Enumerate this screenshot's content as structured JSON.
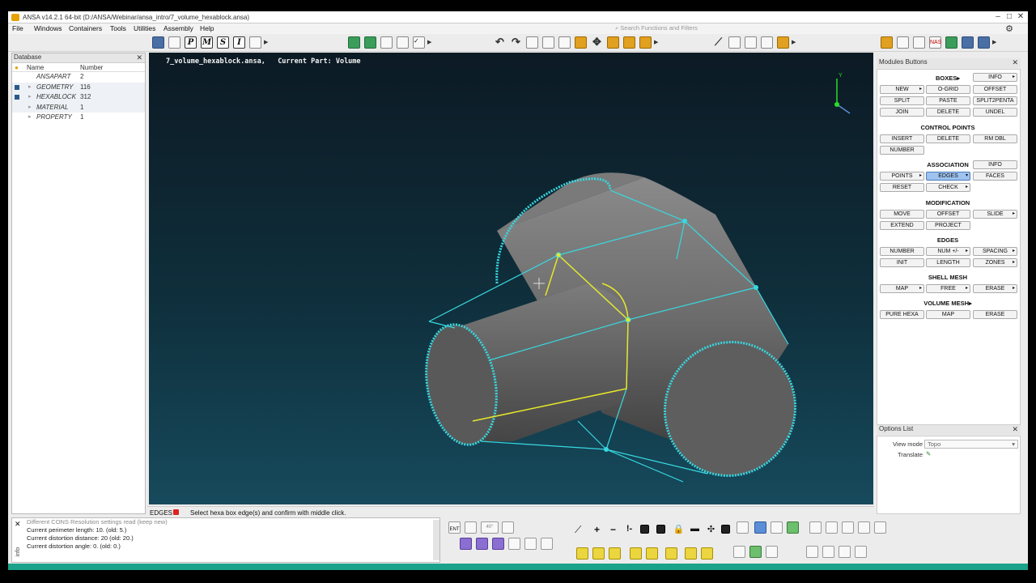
{
  "window": {
    "title": "ANSA v14.2.1 64-bit (D:/ANSA/Webinar/ansa_intro/7_volume_hexablock.ansa)"
  },
  "menu": [
    "File",
    "Windows",
    "Containers",
    "Tools",
    "Utilities",
    "Assembly",
    "Help"
  ],
  "search": {
    "placeholder": "Search Functions and Filters"
  },
  "database": {
    "title": "Database",
    "columns": {
      "name": "Name",
      "number": "Number"
    },
    "rows": [
      {
        "name": "ANSAPART",
        "number": "2"
      },
      {
        "name": "GEOMETRY",
        "number": "116"
      },
      {
        "name": "HEXABLOCK",
        "number": "312"
      },
      {
        "name": "MATERIAL",
        "number": "1"
      },
      {
        "name": "PROPERTY",
        "number": "1"
      }
    ]
  },
  "viewport": {
    "file_label": "7_volume_hexablock.ansa,",
    "part_label": "Current Part: Volume"
  },
  "modules": {
    "title": "Modules Buttons",
    "sections": {
      "boxes": "BOXES",
      "control_points": "CONTROL POINTS",
      "association": "ASSOCIATION",
      "modification": "MODIFICATION",
      "edges": "EDGES",
      "shell_mesh": "SHELL MESH",
      "volume_mesh": "VOLUME MESH"
    },
    "buttons": {
      "boxes_info": "INFO",
      "new": "NEW",
      "ogrid": "O-GRID",
      "offset": "OFFSET",
      "split": "SPLIT",
      "paste": "PASTE",
      "split2penta": "SPLIT2PENTA",
      "join": "JOIN",
      "delete": "DELETE",
      "undel": "UNDEL",
      "insert": "INSERT",
      "cp_delete": "DELETE",
      "rm_dbl": "RM DBL",
      "number": "NUMBER",
      "assoc_info": "INFO",
      "points": "POINTS",
      "edges": "EDGES",
      "faces": "FACES",
      "reset": "RESET",
      "check": "CHECK",
      "move": "MOVE",
      "mod_offset": "OFFSET",
      "slide": "SLIDE",
      "extend": "EXTEND",
      "project": "PROJECT",
      "e_number": "NUMBER",
      "num_pm": "NUM +/-",
      "spacing": "SPACING",
      "init": "INIT",
      "length": "LENGTH",
      "zones": "ZONES",
      "map": "MAP",
      "free": "FREE",
      "erase": "ERASE",
      "pure_hexa": "PURE HEXA",
      "v_map": "MAP",
      "v_erase": "ERASE"
    }
  },
  "options": {
    "title": "Options List",
    "view_mode_label": "View mode",
    "view_mode_value": "Topo",
    "translate_label": "Translate"
  },
  "status": {
    "mode": "EDGES",
    "message": "Select hexa box edge(s) and confirm with middle click."
  },
  "console": {
    "lines": [
      "Different CONS Resolution settings read (keep new)",
      "Current perimeter length: 10. (old: 5.)",
      "Current distortion distance: 20 (old: 20.)",
      "Current distortion angle: 0. (old: 0.)"
    ],
    "side_label": "info"
  },
  "bottom_toolbar": {
    "angle_value": "40",
    "ent_label": "ENT"
  },
  "colors": {
    "accent_cyan": "#38d8e0",
    "highlight_yellow": "#e6e62a",
    "footer": "#1aa38a"
  }
}
